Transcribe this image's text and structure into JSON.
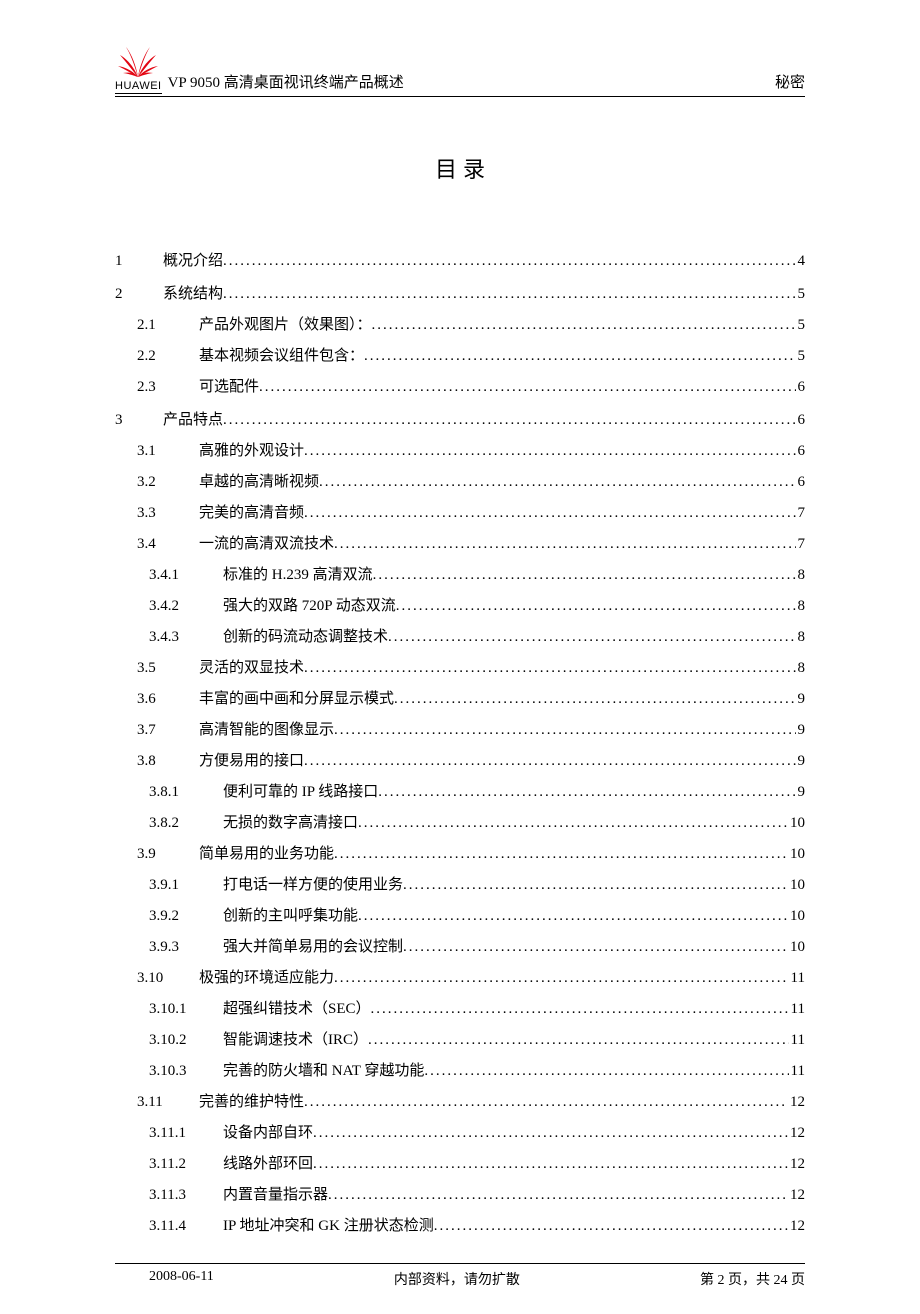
{
  "header": {
    "logo_text": "HUAWEI",
    "doc_title": "VP 9050 高清桌面视讯终端产品概述",
    "classification": "秘密"
  },
  "toc_title": "目 录",
  "toc": [
    {
      "level": 1,
      "num": "1",
      "text": "概况介绍",
      "page": "4"
    },
    {
      "level": 1,
      "num": "2",
      "text": "系统结构",
      "page": "5"
    },
    {
      "level": 2,
      "num": "2.1",
      "text": "产品外观图片（效果图）：",
      "page": "5"
    },
    {
      "level": 2,
      "num": "2.2",
      "text": "基本视频会议组件包含：",
      "page": "5"
    },
    {
      "level": 2,
      "num": "2.3",
      "text": "可选配件",
      "page": "6"
    },
    {
      "level": 1,
      "num": "3",
      "text": "产品特点",
      "page": "6"
    },
    {
      "level": 2,
      "num": "3.1",
      "text": "高雅的外观设计",
      "page": "6"
    },
    {
      "level": 2,
      "num": "3.2",
      "text": "卓越的高清晰视频",
      "page": "6"
    },
    {
      "level": 2,
      "num": "3.3",
      "text": "完美的高清音频",
      "page": "7"
    },
    {
      "level": 2,
      "num": "3.4",
      "text": "一流的高清双流技术",
      "page": "7"
    },
    {
      "level": 3,
      "num": "3.4.1",
      "text": "标准的 H.239 高清双流",
      "page": "8"
    },
    {
      "level": 3,
      "num": "3.4.2",
      "text": "强大的双路 720P 动态双流",
      "page": "8"
    },
    {
      "level": 3,
      "num": "3.4.3",
      "text": "创新的码流动态调整技术",
      "page": "8"
    },
    {
      "level": 2,
      "num": "3.5",
      "text": "灵活的双显技术",
      "page": "8"
    },
    {
      "level": 2,
      "num": "3.6",
      "text": "丰富的画中画和分屏显示模式",
      "page": "9"
    },
    {
      "level": 2,
      "num": "3.7",
      "text": "高清智能的图像显示",
      "page": "9"
    },
    {
      "level": 2,
      "num": "3.8",
      "text": "方便易用的接口",
      "page": "9"
    },
    {
      "level": 3,
      "num": "3.8.1",
      "text": "便利可靠的 IP 线路接口",
      "page": "9"
    },
    {
      "level": 3,
      "num": "3.8.2",
      "text": "无损的数字高清接口",
      "page": "10"
    },
    {
      "level": 2,
      "num": "3.9",
      "text": "简单易用的业务功能",
      "page": "10"
    },
    {
      "level": 3,
      "num": "3.9.1",
      "text": "打电话一样方便的使用业务",
      "page": "10"
    },
    {
      "level": 3,
      "num": "3.9.2",
      "text": "创新的主叫呼集功能",
      "page": "10"
    },
    {
      "level": 3,
      "num": "3.9.3",
      "text": "强大并简单易用的会议控制",
      "page": "10"
    },
    {
      "level": 2,
      "num": "3.10",
      "text": "极强的环境适应能力",
      "page": "11"
    },
    {
      "level": 3,
      "num": "3.10.1",
      "text": "超强纠错技术（SEC）",
      "page": "11"
    },
    {
      "level": 3,
      "num": "3.10.2",
      "text": "智能调速技术（IRC）",
      "page": "11"
    },
    {
      "level": 3,
      "num": "3.10.3",
      "text": "完善的防火墙和 NAT 穿越功能",
      "page": "11"
    },
    {
      "level": 2,
      "num": "3.11",
      "text": "完善的维护特性",
      "page": "12"
    },
    {
      "level": 3,
      "num": "3.11.1",
      "text": "设备内部自环",
      "page": "12"
    },
    {
      "level": 3,
      "num": "3.11.2",
      "text": "线路外部环回",
      "page": "12"
    },
    {
      "level": 3,
      "num": "3.11.3",
      "text": "内置音量指示器",
      "page": "12"
    },
    {
      "level": 3,
      "num": "3.11.4",
      "text": "IP 地址冲突和 GK 注册状态检测",
      "page": "12"
    }
  ],
  "footer": {
    "date": "2008-06-11",
    "center": "内部资料，请勿扩散",
    "right": "第 2 页，共 24 页"
  }
}
